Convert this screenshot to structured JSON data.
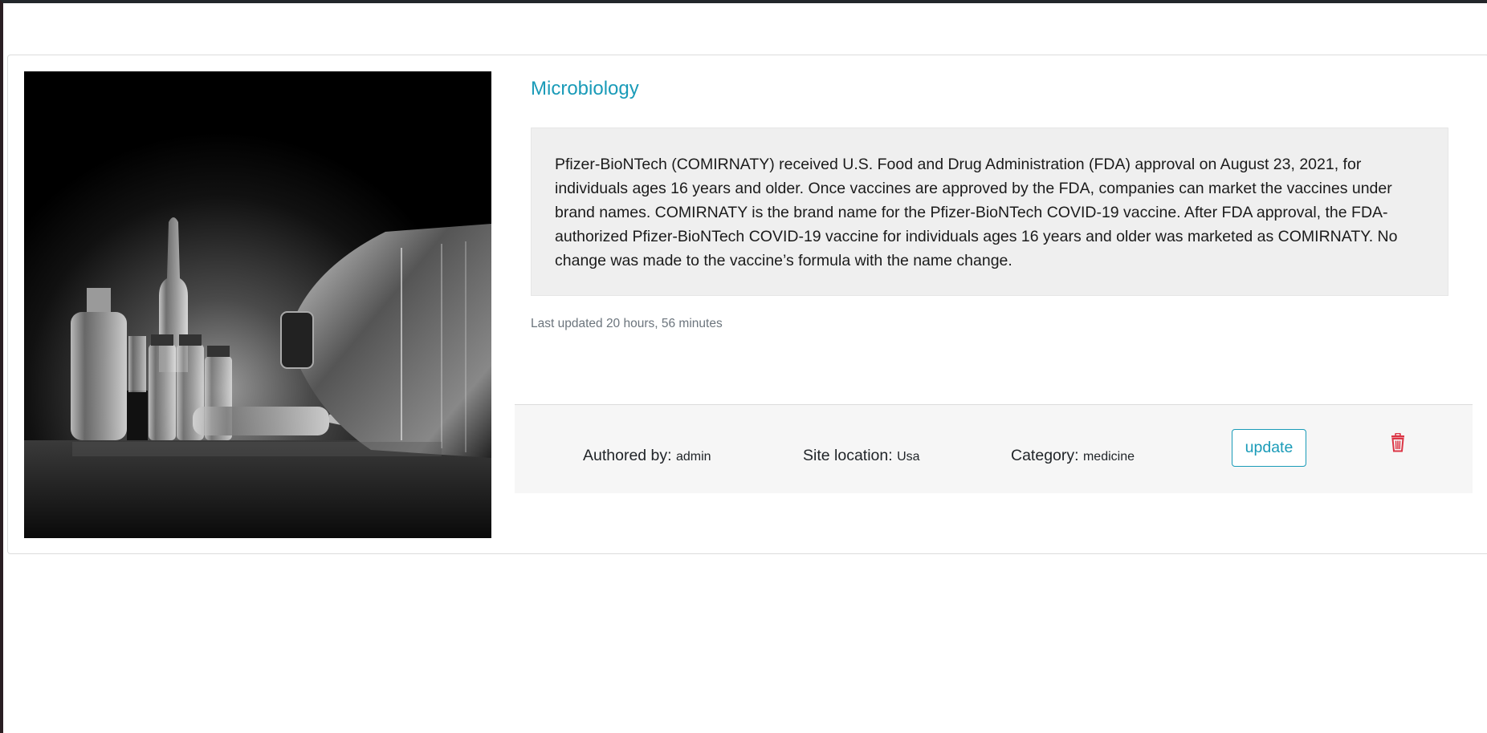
{
  "post": {
    "title": "Microbiology",
    "description": "Pfizer-BioNTech (COMIRNATY) received U.S. Food and Drug Administration (FDA) approval on August 23, 2021, for individuals ages 16 years and older. Once vaccines are approved by the FDA, companies can market the vaccines under brand names. COMIRNATY is the brand name for the Pfizer-BioNTech COVID-19 vaccine. After FDA approval, the FDA-authorized Pfizer-BioNTech COVID-19 vaccine for individuals ages 16 years and older was marketed as COMIRNATY. No change was made to the vaccine’s formula with the name change.",
    "last_updated": "Last updated 20 hours, 56 minutes",
    "image_icon": "vaccine-vials-photo"
  },
  "footer": {
    "author_label": "Authored by:",
    "author_value": "admin",
    "location_label": "Site location:",
    "location_value": "Usa",
    "category_label": "Category:",
    "category_value": "medicine",
    "update_label": "update",
    "delete_icon": "trash-icon"
  },
  "colors": {
    "accent": "#1a9bb8",
    "danger": "#dc3545",
    "description_bg": "#efefef",
    "footer_bg": "#f6f6f6"
  }
}
